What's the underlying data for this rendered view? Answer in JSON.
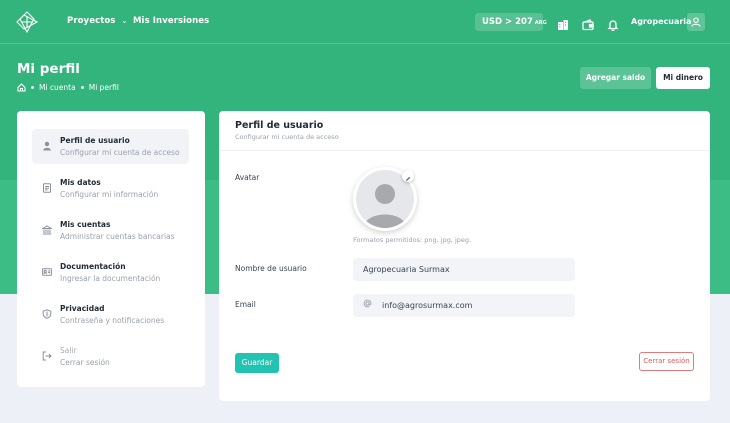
{
  "header": {
    "nav": [
      {
        "label": "Proyectos",
        "has_dropdown": true
      },
      {
        "label": "Mis Inversiones",
        "has_dropdown": false
      }
    ],
    "exchange": {
      "prefix": "USD > 207",
      "suffix": "ARG"
    },
    "icons": [
      "building-icon",
      "wallet-icon",
      "bell-icon"
    ],
    "company": "Agropecuaria",
    "user_icon": "user-icon"
  },
  "page": {
    "title": "Mi perfil",
    "breadcrumb": [
      "Mi cuenta",
      "Mi perfil"
    ],
    "actions": {
      "add_balance": "Agregar saldo",
      "my_money": "Mi dinero"
    }
  },
  "sidebar": {
    "items": [
      {
        "title": "Perfil de usuario",
        "subtitle": "Configurar mi cuenta de acceso",
        "icon": "user-icon",
        "active": true
      },
      {
        "title": "Mis datos",
        "subtitle": "Configurar mi información",
        "icon": "document-icon",
        "active": false
      },
      {
        "title": "Mis cuentas",
        "subtitle": "Administrar cuentas bancarias",
        "icon": "bank-icon",
        "active": false
      },
      {
        "title": "Documentación",
        "subtitle": "Ingresar la documentación",
        "icon": "id-card-icon",
        "active": false
      },
      {
        "title": "Privacidad",
        "subtitle": "Contraseña y notificaciones",
        "icon": "shield-icon",
        "active": false
      },
      {
        "title": "Salir",
        "subtitle": "Cerrar sesión",
        "icon": "logout-icon",
        "active": false
      }
    ]
  },
  "profile": {
    "title": "Perfil de usuario",
    "subtitle": "Configurar mi cuenta de acceso",
    "avatar_label": "Avatar",
    "formats": "Formatos permitidos: png, jpg, jpeg.",
    "username_label": "Nombre de usuario",
    "username_value": "Agropecuaria Surmax",
    "email_label": "Email",
    "email_value": "info@agrosurmax.com",
    "save": "Guardar",
    "logout": "Cerrar sesión"
  },
  "colors": {
    "brand_green": "#33b47c",
    "save_button": "#22c3b0",
    "logout_border": "#e07b7b",
    "background": "#eef0f8"
  }
}
